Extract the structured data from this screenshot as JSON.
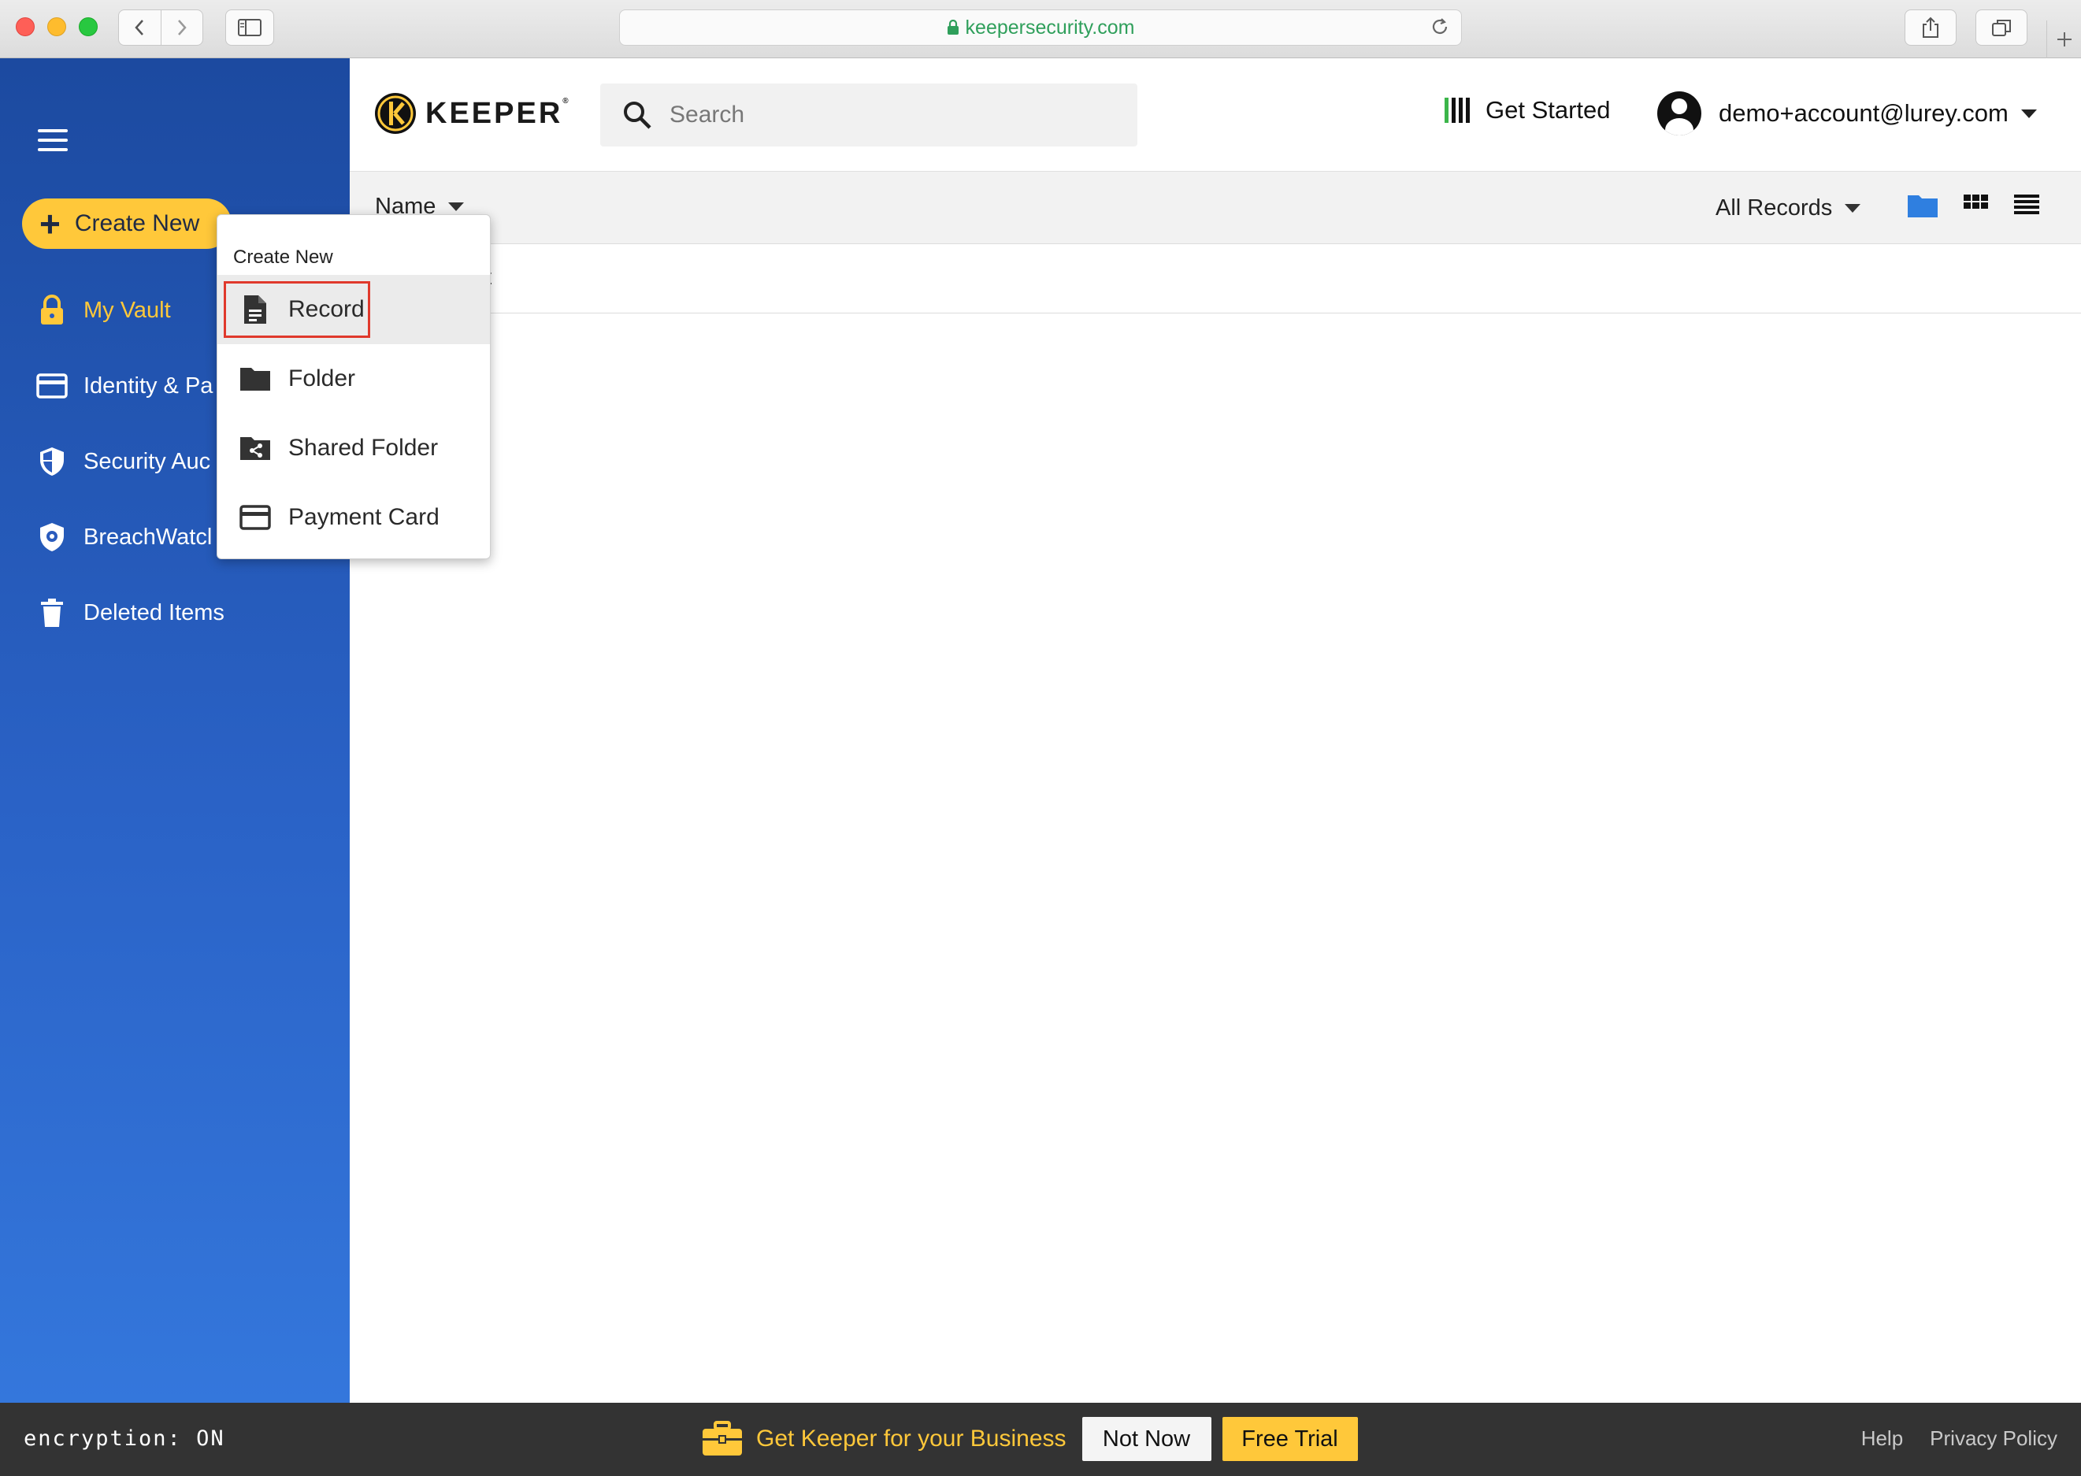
{
  "browser": {
    "url": "keepersecurity.com"
  },
  "sidebar": {
    "create_new_label": "Create New",
    "items": [
      {
        "label": "My Vault",
        "icon": "lock-icon",
        "active": true
      },
      {
        "label": "Identity & Pa",
        "icon": "card-icon",
        "active": false
      },
      {
        "label": "Security Auc",
        "icon": "shield-icon",
        "active": false
      },
      {
        "label": "BreachWatcl",
        "icon": "breachwatch-icon",
        "active": false
      },
      {
        "label": "Deleted Items",
        "icon": "trash-icon",
        "active": false
      }
    ]
  },
  "header": {
    "logo_text": "KEEPER",
    "search_placeholder": "Search",
    "get_started_label": "Get Started",
    "account_email": "demo+account@lurey.com"
  },
  "toolbar": {
    "sort_label": "Name",
    "filter_label": "All Records"
  },
  "content": {
    "row_text": "t"
  },
  "dropdown": {
    "title": "Create New",
    "items": [
      {
        "label": "Record",
        "icon": "document-icon"
      },
      {
        "label": "Folder",
        "icon": "folder-icon"
      },
      {
        "label": "Shared Folder",
        "icon": "shared-folder-icon"
      },
      {
        "label": "Payment Card",
        "icon": "payment-card-icon"
      }
    ]
  },
  "footer": {
    "encryption_status": "encryption: ON",
    "promo_text": "Get Keeper for your Business",
    "not_now_label": "Not Now",
    "free_trial_label": "Free Trial",
    "links": [
      "Help",
      "Privacy Policy"
    ]
  },
  "colors": {
    "accent_yellow": "#ffc83a",
    "sidebar_blue": "#2a62c6",
    "highlight_red": "#e0392c",
    "url_green": "#2f9f5b"
  }
}
